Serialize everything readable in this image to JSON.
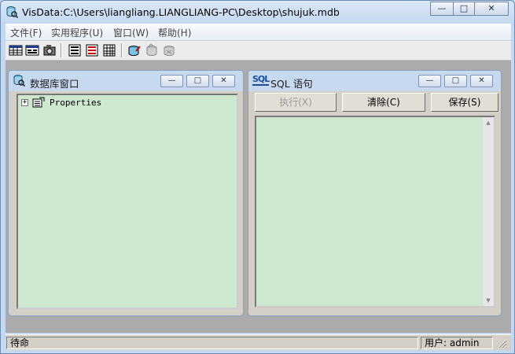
{
  "window": {
    "title": "VisData:C:\\Users\\liangliang.LIANGLIANG-PC\\Desktop\\shujuk.mdb",
    "buttons": {
      "minimize": "—",
      "maximize": "□",
      "close": "✕"
    }
  },
  "menu": [
    "文件(F)",
    "实用程序(U)",
    "窗口(W)",
    "帮助(H)"
  ],
  "toolbar": {
    "icons": [
      "table-icon",
      "dynaset-icon",
      "snapshot-icon",
      "data-control-icon",
      "dbgrid-icon",
      "grid-icon",
      "begin-transaction-icon",
      "commit-icon",
      "rollback-icon"
    ]
  },
  "db_window": {
    "title": "数据库窗口",
    "tree": [
      {
        "expander": "+",
        "label": "Properties"
      }
    ]
  },
  "sql_window": {
    "icon_text": "SQL",
    "title": "SQL 语句",
    "buttons": {
      "execute": "执行(X)",
      "clear": "清除(C)",
      "save": "保存(S)"
    },
    "text": ""
  },
  "status": {
    "message": "待命",
    "user": "用户: admin"
  }
}
